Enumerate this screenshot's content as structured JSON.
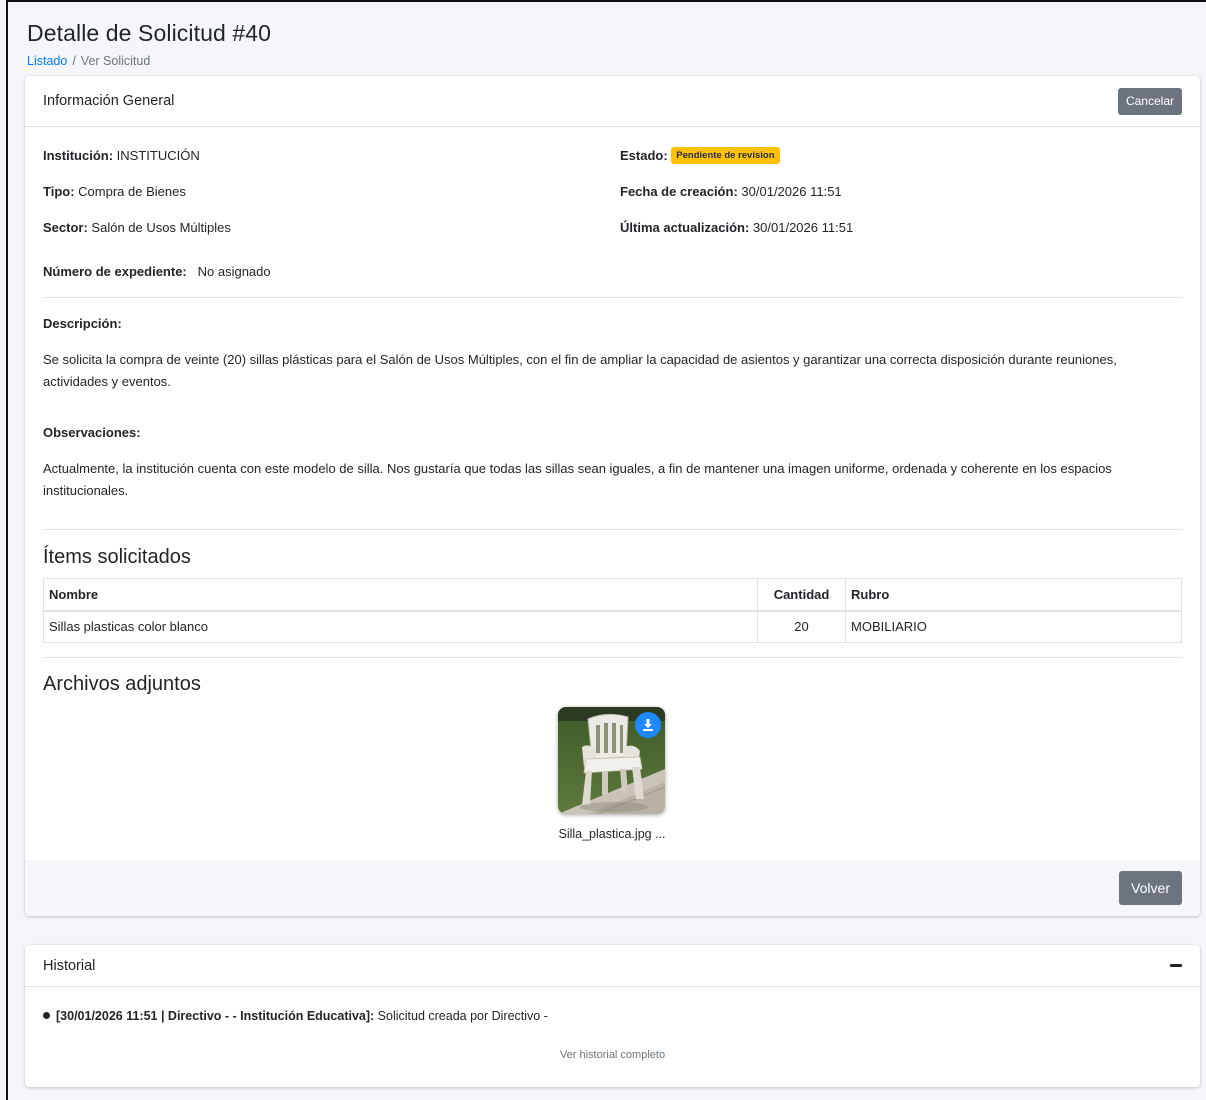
{
  "page": {
    "title": "Detalle de Solicitud #40",
    "breadcrumb": {
      "link": "Listado",
      "separator": "/",
      "current": "Ver Solicitud"
    }
  },
  "general": {
    "header": "Información General",
    "cancel_label": "Cancelar",
    "institucion_label": "Institución:",
    "institucion_value": "INSTITUCIÓN",
    "tipo_label": "Tipo:",
    "tipo_value": "Compra de Bienes",
    "sector_label": "Sector:",
    "sector_value": "Salón de Usos Múltiples",
    "expediente_label": "Número de expediente:",
    "expediente_value": "No asignado",
    "estado_label": "Estado:",
    "estado_value": "Pendiente de revision",
    "fecha_creacion_label": "Fecha de creación:",
    "fecha_creacion_value": "30/01/2026 11:51",
    "ultima_act_label": "Última actualización:",
    "ultima_act_value": "30/01/2026 11:51",
    "descripcion_label": "Descripción:",
    "descripcion_text": "Se solicita la compra de veinte (20) sillas plásticas para el Salón de Usos Múltiples, con el fin de ampliar la capacidad de asientos y garantizar una correcta disposición durante reuniones, actividades y eventos.",
    "observaciones_label": "Observaciones:",
    "observaciones_text": "Actualmente, la institución cuenta con este modelo de silla. Nos gustaría que todas las sillas sean iguales, a fin de mantener una imagen uniforme, ordenada y coherente en los espacios institucionales."
  },
  "items": {
    "heading": "Ítems solicitados",
    "columns": [
      "Nombre",
      "Cantidad",
      "Rubro"
    ],
    "rows": [
      {
        "nombre": "Sillas plasticas color blanco",
        "cantidad": "20",
        "rubro": "MOBILIARIO"
      }
    ]
  },
  "attachments": {
    "heading": "Archivos adjuntos",
    "files": [
      {
        "name": "Silla_plastica.jpg ..."
      }
    ]
  },
  "footer": {
    "back_label": "Volver"
  },
  "historial": {
    "header": "Historial",
    "entry_bold": "[30/01/2026 11:51 | Directivo - - Institución Educativa]:",
    "entry_text": " Solicitud creada por Directivo -",
    "link_label": "Ver historial completo"
  },
  "colors": {
    "primary_link": "#007bff",
    "badge_warning": "#ffc107",
    "button_secondary": "#6c757d",
    "download_button": "#1e88ff"
  },
  "icons": {
    "download": "download-icon",
    "collapse": "minus-icon"
  }
}
